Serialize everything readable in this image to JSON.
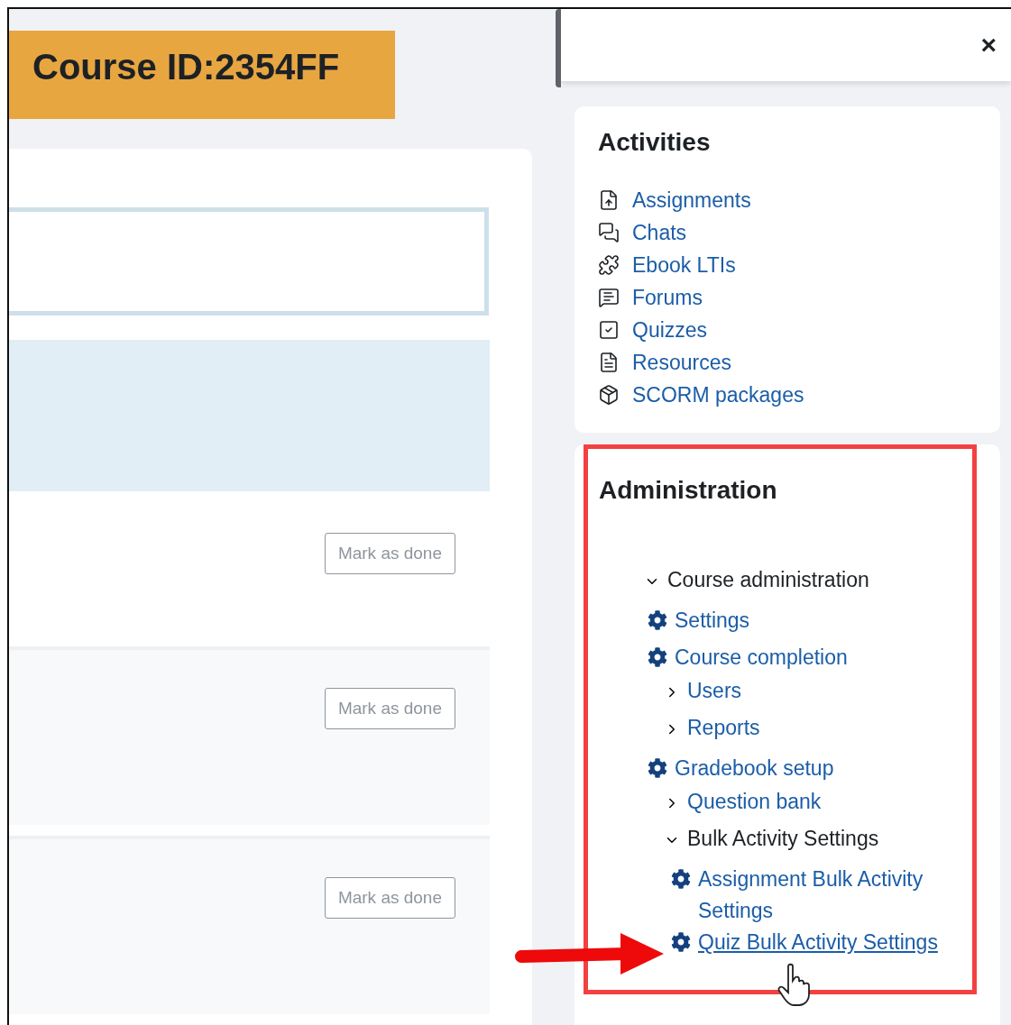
{
  "course_header": {
    "title": "Course ID:2354FF"
  },
  "course_sections": [
    {
      "kind": "first",
      "button": "Mark as done"
    },
    {
      "kind": "plain",
      "button": "Mark as done"
    },
    {
      "kind": "plain",
      "button": "Mark as done"
    }
  ],
  "drawer": {
    "close": "×"
  },
  "activities": {
    "title": "Activities",
    "items": [
      {
        "kind": "assignment",
        "label": "Assignments"
      },
      {
        "kind": "chat",
        "label": "Chats"
      },
      {
        "kind": "lti",
        "label": "Ebook LTIs"
      },
      {
        "kind": "forum",
        "label": "Forums"
      },
      {
        "kind": "quiz",
        "label": "Quizzes"
      },
      {
        "kind": "resource",
        "label": "Resources"
      },
      {
        "kind": "scorm",
        "label": "SCORM packages"
      }
    ]
  },
  "administration": {
    "title": "Administration",
    "tree": [
      {
        "kind": "branch",
        "label": "Course administration",
        "expanded": true,
        "children": [
          {
            "kind": "leaf",
            "label": "Settings",
            "hovered": false
          },
          {
            "kind": "leaf",
            "label": "Course completion",
            "hovered": false
          },
          {
            "kind": "branch",
            "label": "Users",
            "expanded": false
          },
          {
            "kind": "branch",
            "label": "Reports",
            "expanded": false
          },
          {
            "kind": "leaf",
            "label": "Gradebook setup",
            "hovered": false
          },
          {
            "kind": "branch",
            "label": "Question bank",
            "expanded": false
          },
          {
            "kind": "branch",
            "label": "Bulk Activity Settings",
            "expanded": true,
            "children": [
              {
                "kind": "leaf",
                "label": "Assignment Bulk Activity Settings",
                "hovered": false
              },
              {
                "kind": "leaf",
                "label": "Quiz Bulk Activity Settings",
                "hovered": true
              }
            ]
          }
        ]
      }
    ]
  }
}
